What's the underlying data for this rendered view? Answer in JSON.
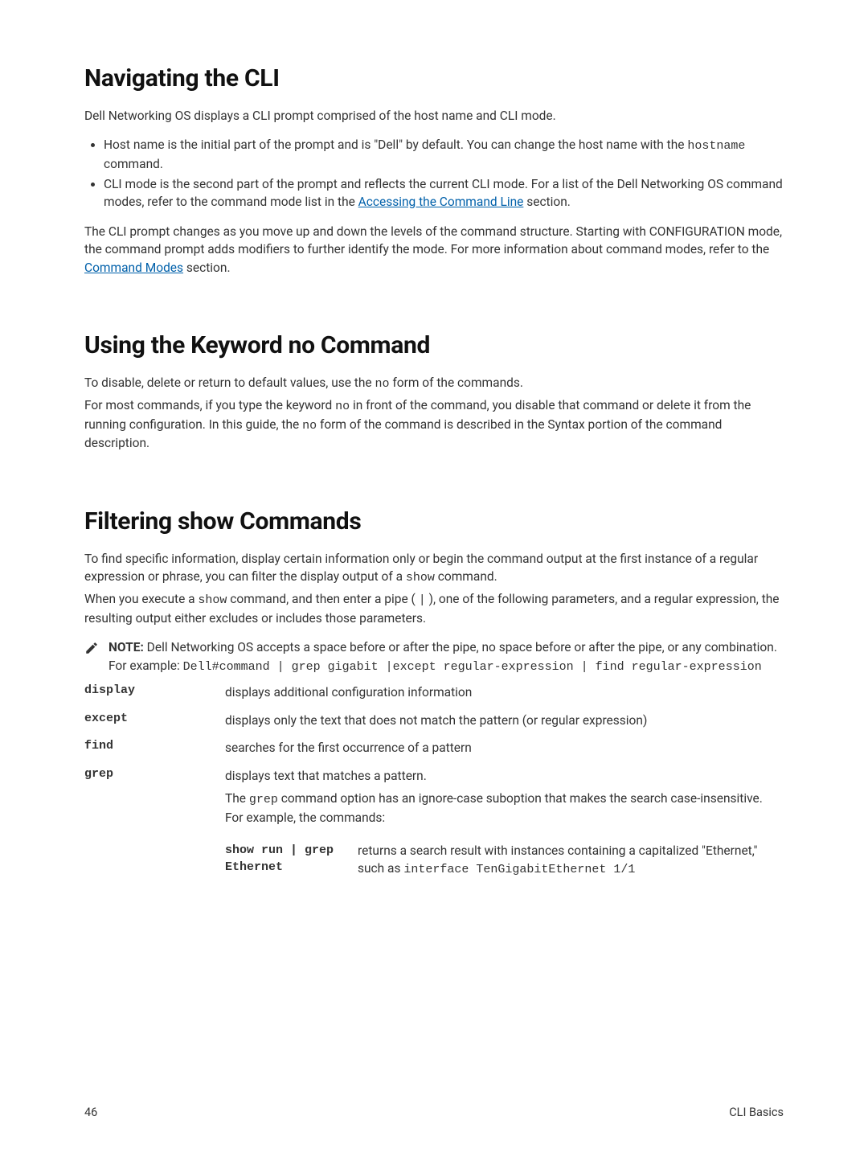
{
  "sections": {
    "nav": {
      "title": "Navigating the CLI",
      "intro": "Dell Networking OS displays a CLI prompt comprised of the host name and CLI mode.",
      "b1a": "Host name is the initial part of the prompt and is \"Dell\" by default. You can change the host name with the ",
      "b1_cmd": "hostname",
      "b1b": " command.",
      "b2a": "CLI mode is the second part of the prompt and reflects the current CLI mode. For a list of the Dell Networking OS command modes, refer to the command mode list in the ",
      "b2_link": "Accessing the Command Line",
      "b2b": " section.",
      "p2a": "The CLI prompt changes as you move up and down the levels of the command structure. Starting with CONFIGURATION mode, the command prompt adds modifiers to further identify the mode. For more information about command modes, refer to the ",
      "p2_link": "Command Modes",
      "p2b": " section."
    },
    "no": {
      "title": "Using the Keyword no Command",
      "p1a": "To disable, delete or return to default values, use the ",
      "p1_no": "no",
      "p1b": " form of the commands.",
      "p2a": "For most commands, if you type the keyword ",
      "p2_no1": "no",
      "p2b": " in front of the command, you disable that command or delete it from the running configuration. In this guide, the ",
      "p2_no2": "no",
      "p2c": " form of the command is described in the Syntax portion of the command description."
    },
    "filter": {
      "title": "Filtering show Commands",
      "p1a": "To find specific information, display certain information only or begin the command output at the first instance of a regular expression or phrase, you can filter the display output of a ",
      "p1_show": "show",
      "p1b": " command.",
      "p2a": "When you execute a ",
      "p2_show": "show",
      "p2b": " command, and then enter a pipe ( ",
      "p2_pipe": "|",
      "p2c": " ), one of the following parameters, and a regular expression, the resulting output either excludes or includes those parameters.",
      "note_label": "NOTE:",
      "note_a": "Dell Networking OS accepts a space before or after the pipe, no space before or after the pipe, or any combination. For example: ",
      "note_code": "Dell#command | grep gigabit |except regular-expression | find regular-expression",
      "defs": {
        "display_t": "display",
        "display_d": "displays additional configuration information",
        "except_t": "except",
        "except_d": "displays only the text that does not match the pattern (or regular expression)",
        "find_t": "find",
        "find_d": "searches for the first occurrence of a pattern",
        "grep_t": "grep",
        "grep_d1": "displays text that matches a pattern.",
        "grep_d2a": "The ",
        "grep_d2_code": "grep",
        "grep_d2b": " command option has an ignore-case suboption that makes the search case-insensitive. For example, the commands:",
        "inner_term": "show run | grep Ethernet",
        "inner_desc_a": "returns a search result with instances containing a capitalized \"Ethernet,\" such as ",
        "inner_desc_code": "interface TenGigabitEthernet 1/1"
      }
    }
  },
  "footer": {
    "page": "46",
    "section": "CLI Basics"
  }
}
